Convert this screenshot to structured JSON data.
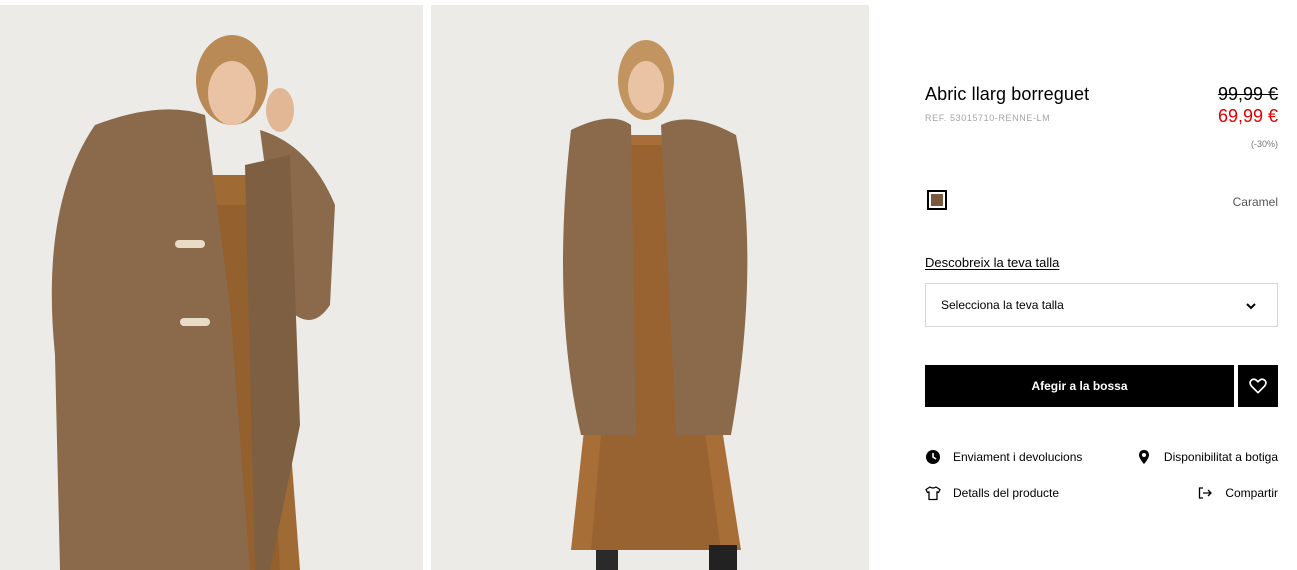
{
  "product": {
    "title": "Abric llarg borreguet",
    "ref": "REF. 53015710-RENNE-LM",
    "old_price": "99,99 €",
    "new_price": "69,99 €",
    "discount": "(-30%)"
  },
  "colors": {
    "selected_name": "Caramel",
    "swatch_color": "#7a5a3e"
  },
  "size": {
    "guide_link": "Descobreix la teva talla",
    "select_label": "Selecciona la teva talla"
  },
  "actions": {
    "add_to_bag": "Afegir a la bossa"
  },
  "links": {
    "shipping": "Enviament i devolucions",
    "store": "Disponibilitat a botiga",
    "details": "Detalls del producte",
    "share": "Compartir"
  },
  "theme": {
    "sale_color": "#e00000",
    "button_color": "#000000"
  }
}
